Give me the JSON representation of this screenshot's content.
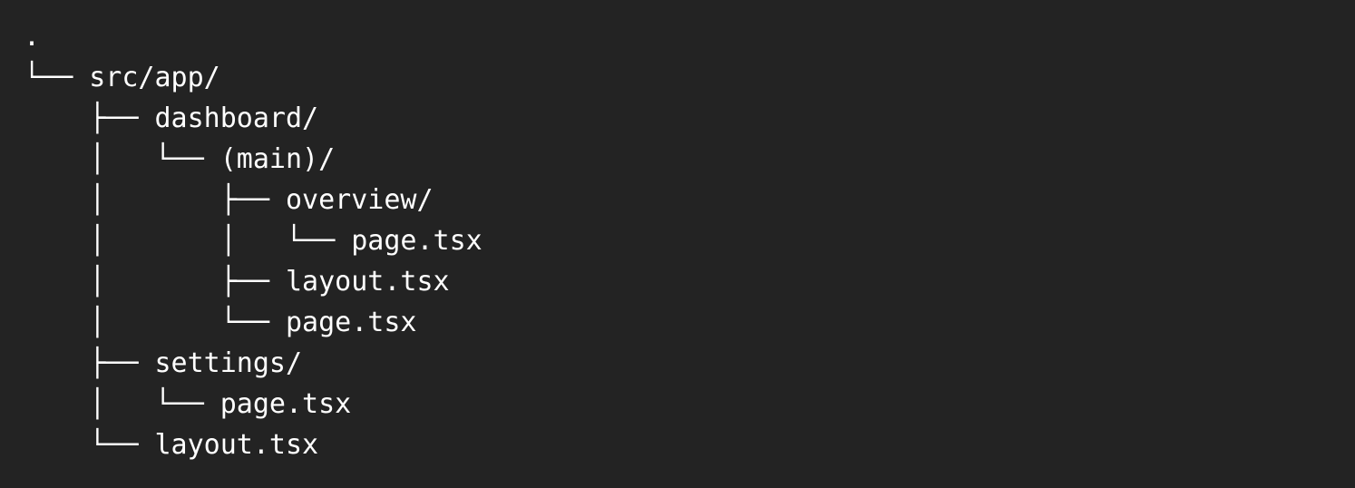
{
  "tree": {
    "lines": [
      {
        "prefix": "",
        "name": "."
      },
      {
        "prefix": "└── ",
        "name": "src/app/"
      },
      {
        "prefix": "    ├── ",
        "name": "dashboard/"
      },
      {
        "prefix": "    │   └── ",
        "name": "(main)/"
      },
      {
        "prefix": "    │       ├── ",
        "name": "overview/"
      },
      {
        "prefix": "    │       │   └── ",
        "name": "page.tsx"
      },
      {
        "prefix": "    │       ├── ",
        "name": "layout.tsx"
      },
      {
        "prefix": "    │       └── ",
        "name": "page.tsx"
      },
      {
        "prefix": "    ├── ",
        "name": "settings/"
      },
      {
        "prefix": "    │   └── ",
        "name": "page.tsx"
      },
      {
        "prefix": "    └── ",
        "name": "layout.tsx"
      }
    ]
  }
}
